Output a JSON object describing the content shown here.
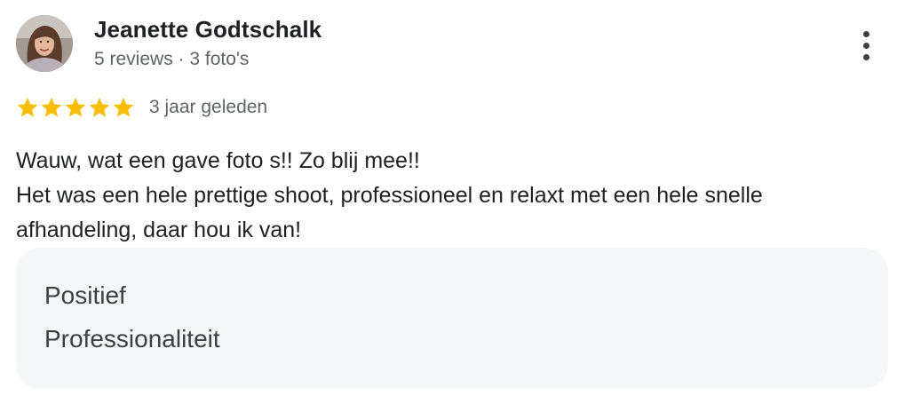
{
  "review": {
    "author": {
      "name": "Jeanette Godtschalk",
      "meta": "5 reviews · 3 foto's",
      "avatar_icon": "profile-photo"
    },
    "more_icon": "more-vert-icon",
    "rating": {
      "stars": 5,
      "max_stars": 5,
      "star_color": "#fbbc04",
      "time_ago": "3 jaar geleden"
    },
    "text_lines": [
      "Wauw, wat een gave foto s!! Zo blij mee!!",
      "Het was een hele prettige shoot, professioneel en relaxt met een hele snelle",
      "afhandeling, daar hou ik van!"
    ],
    "attributes": [
      "Positief",
      "Professionaliteit"
    ]
  }
}
